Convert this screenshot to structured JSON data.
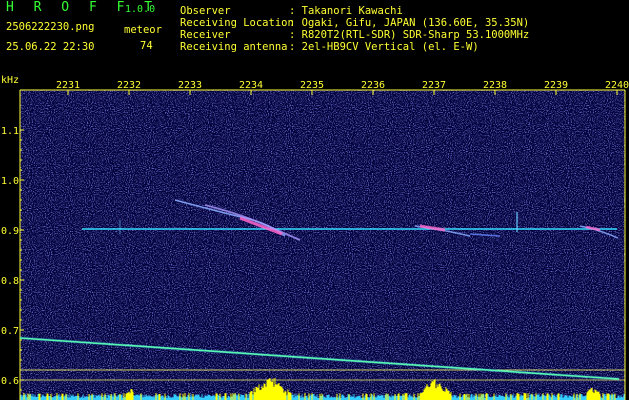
{
  "app": {
    "title": "H R O F F T",
    "version": "1.0.0"
  },
  "file_name": "2506222230.png",
  "meteor_label": "meteor",
  "meteor_count": "74",
  "date_time": "25.06.22 22:30",
  "info": [
    {
      "label": "Observer",
      "value": ": Takanori Kawachi"
    },
    {
      "label": "Receiving Location",
      "value": ": Ogaki, Gifu, JAPAN (136.60E, 35.35N)"
    },
    {
      "label": "Receiver",
      "value": ": R820T2(RTL-SDR) SDR-Sharp 53.1000MHz"
    },
    {
      "label": "Receiving antenna",
      "value": ": 2el-HB9CV Vertical (el. E-W)"
    }
  ],
  "plot": {
    "y_unit": "kHz",
    "y_ticks": [
      "1.1",
      "1.0",
      "0.9",
      "0.8",
      "0.7",
      "0.6"
    ],
    "x_ticks": [
      "2231",
      "2232",
      "2233",
      "2234",
      "2235",
      "2236",
      "2237",
      "2238",
      "2239",
      "2240"
    ],
    "colors": {
      "axis": "#ffff33",
      "background": "#00003a",
      "noise": "#3a3ad8",
      "carrier": "#33ddff",
      "echo": "#ff66cc",
      "level": "#ffff00"
    }
  }
}
